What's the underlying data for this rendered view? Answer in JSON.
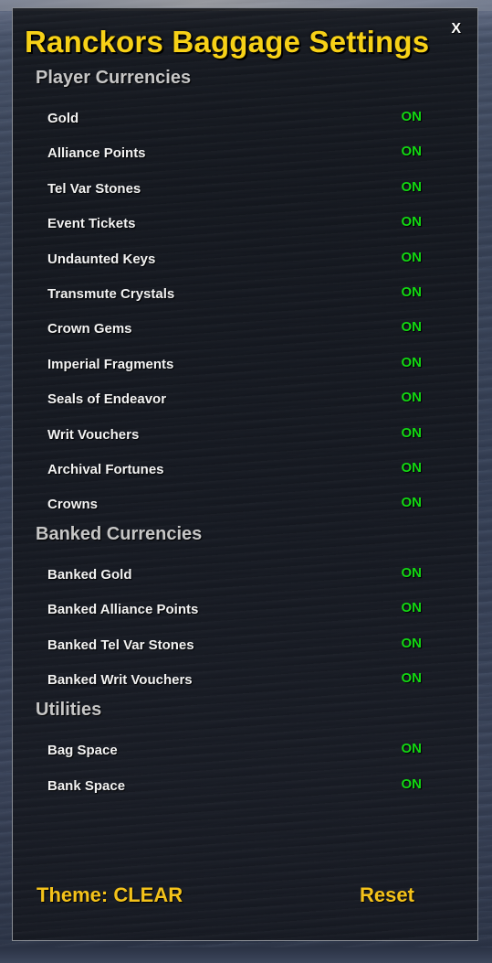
{
  "window": {
    "title": "Ranckors Baggage Settings",
    "close_label": "X"
  },
  "sections": {
    "player": {
      "header": "Player Currencies",
      "items": [
        {
          "label": "Gold",
          "state": "ON"
        },
        {
          "label": "Alliance Points",
          "state": "ON"
        },
        {
          "label": "Tel Var Stones",
          "state": "ON"
        },
        {
          "label": "Event Tickets",
          "state": "ON"
        },
        {
          "label": "Undaunted Keys",
          "state": "ON"
        },
        {
          "label": "Transmute Crystals",
          "state": "ON"
        },
        {
          "label": "Crown Gems",
          "state": "ON"
        },
        {
          "label": "Imperial Fragments",
          "state": "ON"
        },
        {
          "label": "Seals of Endeavor",
          "state": "ON"
        },
        {
          "label": "Writ Vouchers",
          "state": "ON"
        },
        {
          "label": "Archival Fortunes",
          "state": "ON"
        },
        {
          "label": "Crowns",
          "state": "ON"
        }
      ]
    },
    "banked": {
      "header": "Banked Currencies",
      "items": [
        {
          "label": "Banked Gold",
          "state": "ON"
        },
        {
          "label": "Banked Alliance Points",
          "state": "ON"
        },
        {
          "label": "Banked Tel Var Stones",
          "state": "ON"
        },
        {
          "label": "Banked Writ Vouchers",
          "state": "ON"
        }
      ]
    },
    "utilities": {
      "header": "Utilities",
      "items": [
        {
          "label": "Bag Space",
          "state": "ON"
        },
        {
          "label": "Bank Space",
          "state": "ON"
        }
      ]
    }
  },
  "footer": {
    "theme_label": "Theme: CLEAR",
    "reset_label": "Reset"
  },
  "colors": {
    "title": "#f7d117",
    "toggle_on": "#13d813",
    "section_header": "#c6c6c6",
    "footer": "#f4c21a"
  }
}
